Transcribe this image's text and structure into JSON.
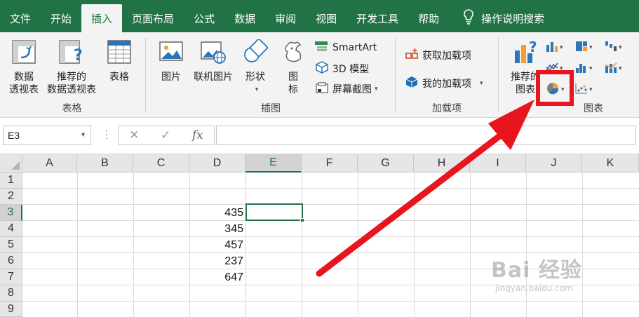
{
  "tabs": [
    {
      "label": "文件",
      "active": false
    },
    {
      "label": "开始",
      "active": false
    },
    {
      "label": "插入",
      "active": true
    },
    {
      "label": "页面布局",
      "active": false
    },
    {
      "label": "公式",
      "active": false
    },
    {
      "label": "数据",
      "active": false
    },
    {
      "label": "审阅",
      "active": false
    },
    {
      "label": "视图",
      "active": false
    },
    {
      "label": "开发工具",
      "active": false
    },
    {
      "label": "帮助",
      "active": false
    }
  ],
  "tell_me": {
    "label": "操作说明搜索",
    "icon": "lightbulb-icon"
  },
  "ribbon": {
    "tables": {
      "label": "表格",
      "pivot_line1": "数据",
      "pivot_line2": "透视表",
      "rec_pivot_line1": "推荐的",
      "rec_pivot_line2": "数据透视表",
      "table": "表格"
    },
    "illustrations": {
      "label": "插图",
      "pictures": "图片",
      "online_pictures": "联机图片",
      "shapes": "形状",
      "icons_line1": "图",
      "icons_line2": "标",
      "smartart": "SmartArt",
      "model3d": "3D 模型",
      "screenshot": "屏幕截图"
    },
    "addins": {
      "label": "加载项",
      "get": "获取加载项",
      "mine": "我的加载项"
    },
    "charts": {
      "label": "图表",
      "recommended_line1": "推荐的",
      "recommended_line2": "图表"
    }
  },
  "formula_bar": {
    "name_box": "E3",
    "fx": "fx",
    "cancel": "✕",
    "enter": "✓",
    "value": ""
  },
  "sheet": {
    "columns": [
      "A",
      "B",
      "C",
      "D",
      "E",
      "F",
      "G",
      "H",
      "I",
      "J",
      "K"
    ],
    "selected_column": "E",
    "rows": [
      "1",
      "2",
      "3",
      "4",
      "5",
      "6",
      "7",
      "8",
      "9"
    ],
    "selected_row": "3",
    "active_cell": "E3",
    "cells": {
      "D3": "435",
      "D4": "345",
      "D5": "457",
      "D6": "237",
      "D7": "647"
    }
  },
  "colors": {
    "excel_green": "#217346",
    "annotation_red": "#e8141e"
  },
  "watermark": {
    "main": "Bai 经验",
    "url": "jingyan.baidu.com"
  }
}
